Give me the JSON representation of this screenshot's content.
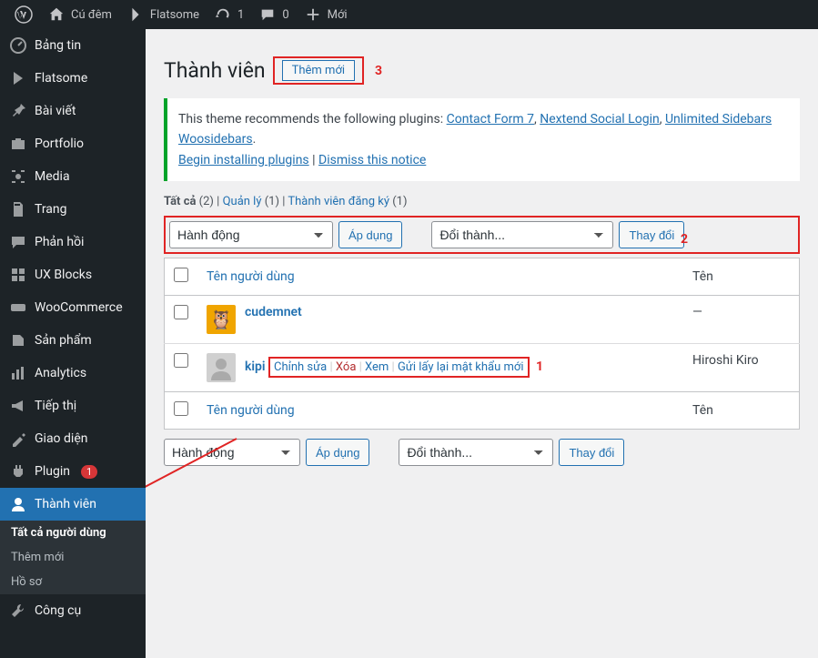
{
  "adminBar": {
    "site": "Cú đêm",
    "theme": "Flatsome",
    "updates": "1",
    "comments": "0",
    "new": "Mới"
  },
  "sidebar": {
    "items": [
      {
        "label": "Bảng tin"
      },
      {
        "label": "Flatsome"
      },
      {
        "label": "Bài viết"
      },
      {
        "label": "Portfolio"
      },
      {
        "label": "Media"
      },
      {
        "label": "Trang"
      },
      {
        "label": "Phản hồi"
      },
      {
        "label": "UX Blocks"
      },
      {
        "label": "WooCommerce"
      },
      {
        "label": "Sản phẩm"
      },
      {
        "label": "Analytics"
      },
      {
        "label": "Tiếp thị"
      },
      {
        "label": "Giao diện"
      },
      {
        "label": "Plugin",
        "badge": "1"
      },
      {
        "label": "Thành viên"
      },
      {
        "label": "Công cụ"
      }
    ],
    "submenu": [
      {
        "label": "Tất cả người dùng",
        "current": true
      },
      {
        "label": "Thêm mới"
      },
      {
        "label": "Hồ sơ"
      }
    ]
  },
  "page": {
    "title": "Thành viên",
    "addNew": "Thêm mới",
    "marker3": "3",
    "marker2": "2",
    "marker1": "1"
  },
  "notice": {
    "intro": "This theme recommends the following plugins: ",
    "plugin1": "Contact Form 7",
    "plugin2": "Nextend Social Login",
    "plugin3": "Unlimited Sidebars Woosidebars",
    "sep": ", ",
    "period": ".",
    "begin": "Begin installing plugins",
    "bar": " | ",
    "dismiss": "Dismiss this notice"
  },
  "filters": {
    "all": "Tất cả",
    "allCount": "(2)",
    "admin": "Quản lý",
    "adminCount": "(1)",
    "subscriber": "Thành viên đăng ký",
    "subscriberCount": "(1)",
    "sep": " | "
  },
  "actions": {
    "bulk": "Hành động",
    "apply": "Áp dụng",
    "changeRole": "Đổi thành...",
    "change": "Thay đổi"
  },
  "table": {
    "colUser": "Tên người dùng",
    "colName": "Tên",
    "rows": [
      {
        "username": "cudemnet",
        "name": "—"
      },
      {
        "username": "kipi",
        "name": "Hiroshi Kiro"
      }
    ],
    "rowActions": {
      "edit": "Chỉnh sửa",
      "delete": "Xóa",
      "view": "Xem",
      "resetPwd": "Gửi lấy lại mật khẩu mới",
      "sep": " | "
    }
  }
}
